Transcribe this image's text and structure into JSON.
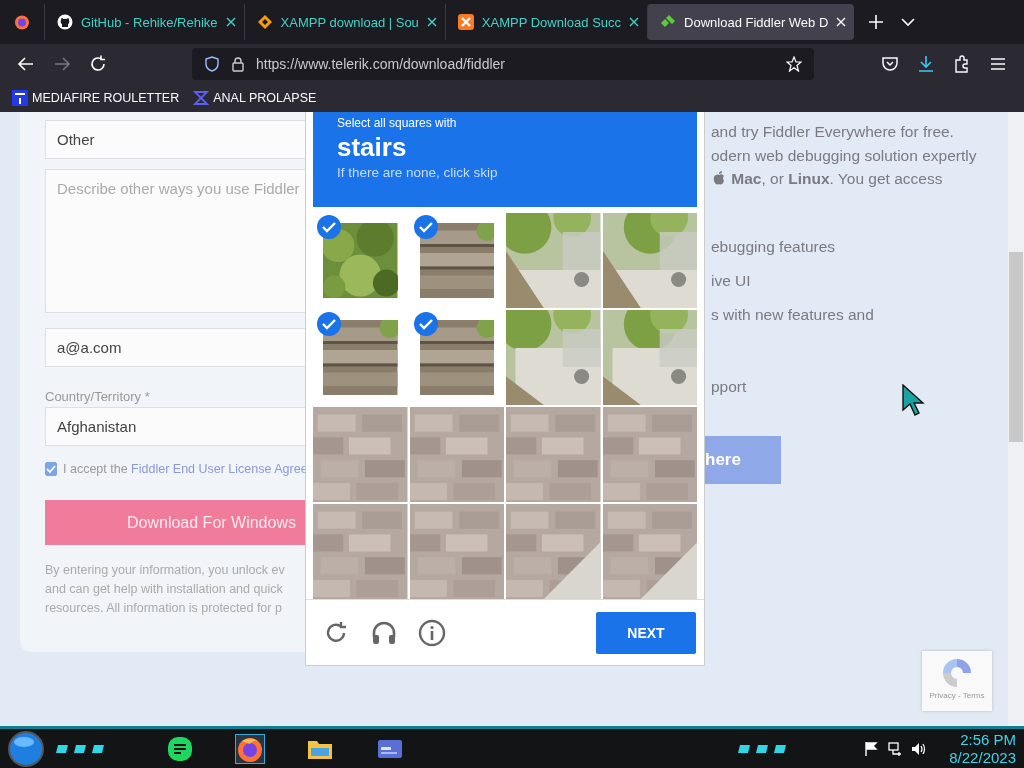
{
  "browser": {
    "tabs": [
      {
        "title": "GitHub - Rehike/Rehike",
        "kind": "github",
        "selected": false
      },
      {
        "title": "XAMPP download | Sou",
        "kind": "diamond",
        "selected": false
      },
      {
        "title": "XAMPP Download Succ",
        "kind": "xampp",
        "selected": false
      },
      {
        "title": "Download Fiddler Web D",
        "kind": "fiddler",
        "selected": true
      }
    ],
    "url": "https://www.telerik.com/download/fiddler",
    "bookmarks": [
      {
        "label": "MEDIAFIRE ROULETTER",
        "kind": "square"
      },
      {
        "label": "ANAL PROLAPSE",
        "kind": "sigma"
      }
    ]
  },
  "form": {
    "usage_select": "Other",
    "describe_placeholder": "Describe other ways you use Fiddler",
    "email": "a@a.com",
    "country_label": "Country/Territory *",
    "country": "Afghanistan",
    "accept": {
      "checked": true,
      "text": "I accept the ",
      "link": "Fiddler End User License Agree"
    },
    "download_button": "Download For Windows",
    "disclaimer_lines": [
      "By entering your information, you unlock ev",
      "and can get help with installation and quick",
      "resources. All information is protected for p"
    ]
  },
  "captcha": {
    "prompt": "Select all squares with",
    "target": "stairs",
    "hint": "If there are none, click skip",
    "tiles": [
      {
        "selected": true
      },
      {
        "selected": true
      },
      {
        "selected": false
      },
      {
        "selected": false
      },
      {
        "selected": true
      },
      {
        "selected": true
      },
      {
        "selected": false
      },
      {
        "selected": false
      },
      {
        "selected": false
      },
      {
        "selected": false
      },
      {
        "selected": false
      },
      {
        "selected": false
      },
      {
        "selected": false
      },
      {
        "selected": false
      },
      {
        "selected": false
      },
      {
        "selected": false
      }
    ],
    "next_button": "NEXT"
  },
  "page_text": {
    "lines": [
      "and try Fiddler Everywhere for free.",
      "odern web debugging solution expertly",
      "**Mac**, or **Linux**. You get access"
    ],
    "features": [
      "ebugging features",
      "ive UI",
      "s with new features and",
      "pport"
    ],
    "cta": "here"
  },
  "recaptcha": {
    "links": "Privacy - Terms"
  },
  "taskbar": {
    "apps": [
      {
        "kind": "notes",
        "selected": false
      },
      {
        "kind": "firefox",
        "selected": true
      },
      {
        "kind": "folder",
        "selected": false
      },
      {
        "kind": "window",
        "selected": false
      }
    ],
    "time": "2:56 PM",
    "date": "8/22/2023"
  }
}
